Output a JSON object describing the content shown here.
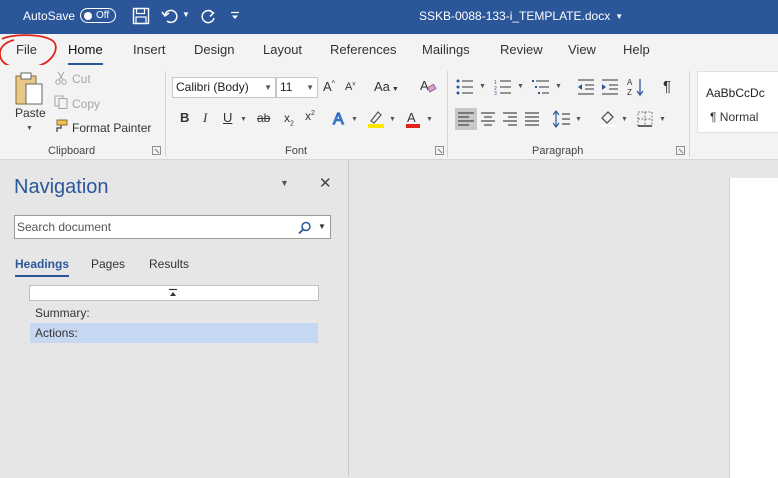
{
  "titlebar": {
    "autosave_label": "AutoSave",
    "autosave_state": "Off",
    "document_title": "SSKB-0088-133-i_TEMPLATE.docx",
    "bg_color": "#2b579a"
  },
  "tabs": [
    {
      "label": "File"
    },
    {
      "label": "Home",
      "active": true
    },
    {
      "label": "Insert"
    },
    {
      "label": "Design"
    },
    {
      "label": "Layout"
    },
    {
      "label": "References"
    },
    {
      "label": "Mailings"
    },
    {
      "label": "Review"
    },
    {
      "label": "View"
    },
    {
      "label": "Help"
    }
  ],
  "ribbon": {
    "clipboard": {
      "paste_label": "Paste",
      "cut_label": "Cut",
      "copy_label": "Copy",
      "format_painter_label": "Format Painter",
      "group_label": "Clipboard"
    },
    "font": {
      "font_name": "Calibri (Body)",
      "font_size": "11",
      "change_case_label": "Aa",
      "group_label": "Font"
    },
    "paragraph": {
      "group_label": "Paragraph"
    },
    "styles": {
      "sample_text": "AaBbCcDc",
      "style_name": "¶ Normal"
    }
  },
  "navigation": {
    "title": "Navigation",
    "search_placeholder": "Search document",
    "tabs": [
      {
        "label": "Headings",
        "active": true
      },
      {
        "label": "Pages"
      },
      {
        "label": "Results"
      }
    ],
    "headings": [
      {
        "label": "Summary:",
        "selected": false
      },
      {
        "label": "Actions:",
        "selected": true
      }
    ]
  },
  "colors": {
    "accent": "#2b579a",
    "selection": "#c5d7f1",
    "annotation": "#e0241b"
  }
}
